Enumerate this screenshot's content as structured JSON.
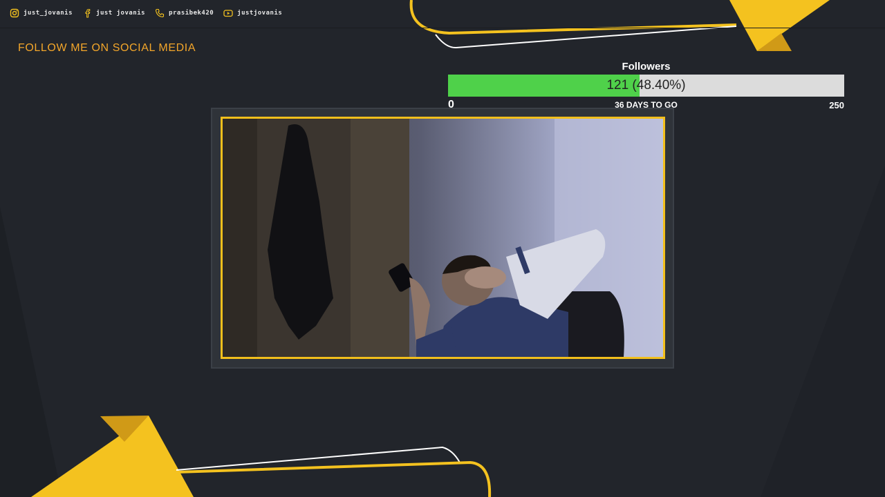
{
  "colors": {
    "background": "#22252b",
    "accent": "#f4c21f",
    "accent_text": "#f3a62a",
    "progress_fill": "#4fd14a",
    "progress_track": "#dcdcdc"
  },
  "social": [
    {
      "icon": "instagram-icon",
      "label": "just_jovanis"
    },
    {
      "icon": "facebook-icon",
      "label": "just jovanis"
    },
    {
      "icon": "phone-icon",
      "label": "prasibek420"
    },
    {
      "icon": "youtube-icon",
      "label": "justjovanis"
    }
  ],
  "follow_title": "FOLLOW ME ON SOCIAL MEDIA",
  "goal": {
    "title": "Followers",
    "value_text": "121 (48.40%)",
    "progress_fraction": 0.484,
    "min": "0",
    "max": "250",
    "days_left": "36 DAYS TO GO"
  }
}
